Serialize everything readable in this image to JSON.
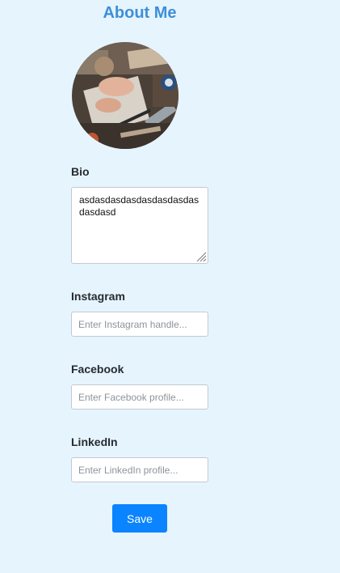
{
  "header": {
    "title": "About Me"
  },
  "profile": {
    "avatar_icon": "profile-photo"
  },
  "bio": {
    "label": "Bio",
    "value": "asdasdasdasdasdasdasdasdasdasd"
  },
  "instagram": {
    "label": "Instagram",
    "placeholder": "Enter Instagram handle..."
  },
  "facebook": {
    "label": "Facebook",
    "placeholder": "Enter Facebook profile..."
  },
  "linkedin": {
    "label": "LinkedIn",
    "placeholder": "Enter LinkedIn profile..."
  },
  "actions": {
    "save_label": "Save"
  },
  "colors": {
    "background": "#e6f4fd",
    "title": "#3d8fd9",
    "button": "#0a84ff"
  }
}
